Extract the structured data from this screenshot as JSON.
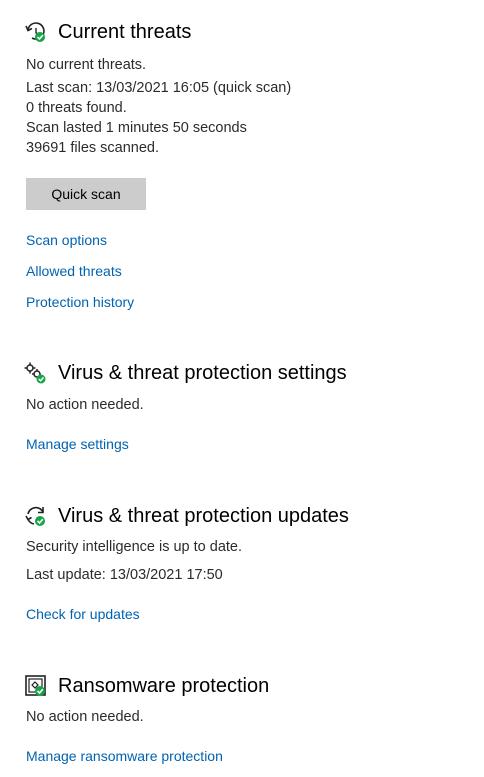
{
  "current_threats": {
    "icon": "shield-refresh-icon",
    "title": "Current threats",
    "lines": [
      "No current threats.",
      "Last scan: 13/03/2021 16:05 (quick scan)",
      "0 threats found.",
      "Scan lasted 1 minutes 50 seconds",
      "39691 files scanned."
    ],
    "button_label": "Quick scan",
    "links": [
      "Scan options",
      "Allowed threats",
      "Protection history"
    ]
  },
  "settings": {
    "icon": "gear-check-icon",
    "title": "Virus & threat protection settings",
    "status": "No action needed.",
    "link": "Manage settings"
  },
  "updates": {
    "icon": "refresh-check-icon",
    "title": "Virus & threat protection updates",
    "status": "Security intelligence is up to date.",
    "last_update": "Last update: 13/03/2021 17:50",
    "link": "Check for updates"
  },
  "ransomware": {
    "icon": "ransomware-folder-icon",
    "title": "Ransomware protection",
    "status": "No action needed.",
    "link": "Manage ransomware protection"
  },
  "colors": {
    "link": "#0063b1",
    "ok_green": "#16a34a",
    "button_bg": "#cccccc"
  }
}
